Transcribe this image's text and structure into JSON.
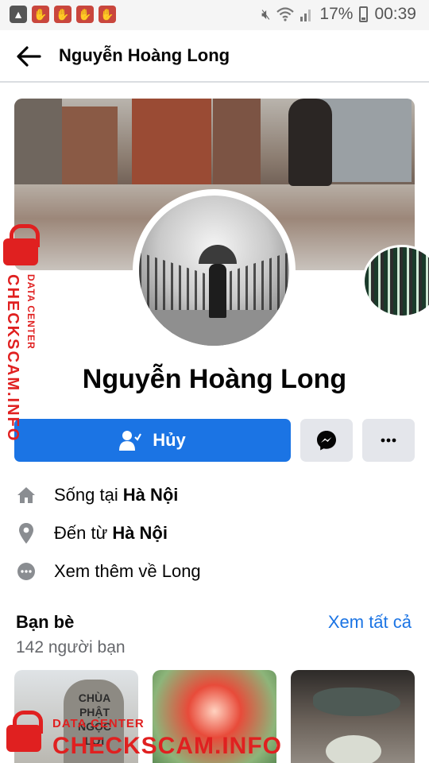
{
  "status_bar": {
    "battery": "17%",
    "time": "00:39",
    "notification_icons": [
      "app-notification-icon",
      "app-notification-icon",
      "app-notification-icon",
      "app-notification-icon"
    ]
  },
  "header": {
    "title": "Nguyễn Hoàng Long"
  },
  "profile": {
    "name": "Nguyễn Hoàng Long"
  },
  "actions": {
    "primary_label": "Hủy"
  },
  "intro": {
    "lives_prefix": "Sống tại",
    "lives_value": "Hà Nội",
    "from_prefix": "Đến từ",
    "from_value": "Hà Nội",
    "more_about": "Xem thêm về Long"
  },
  "friends": {
    "title": "Bạn bè",
    "see_all": "Xem tất cả",
    "count": "142 người bạn",
    "thumb1_text": "CHÙA PHẬT NGỌC LỢI"
  },
  "watermark": {
    "small": "DATA CENTER",
    "large": "CHECKSCAM.INFO"
  },
  "colors": {
    "accent": "#1b74e4",
    "button_gray": "#e4e6eb",
    "secondary_text": "#65676b",
    "watermark": "#e02020"
  }
}
